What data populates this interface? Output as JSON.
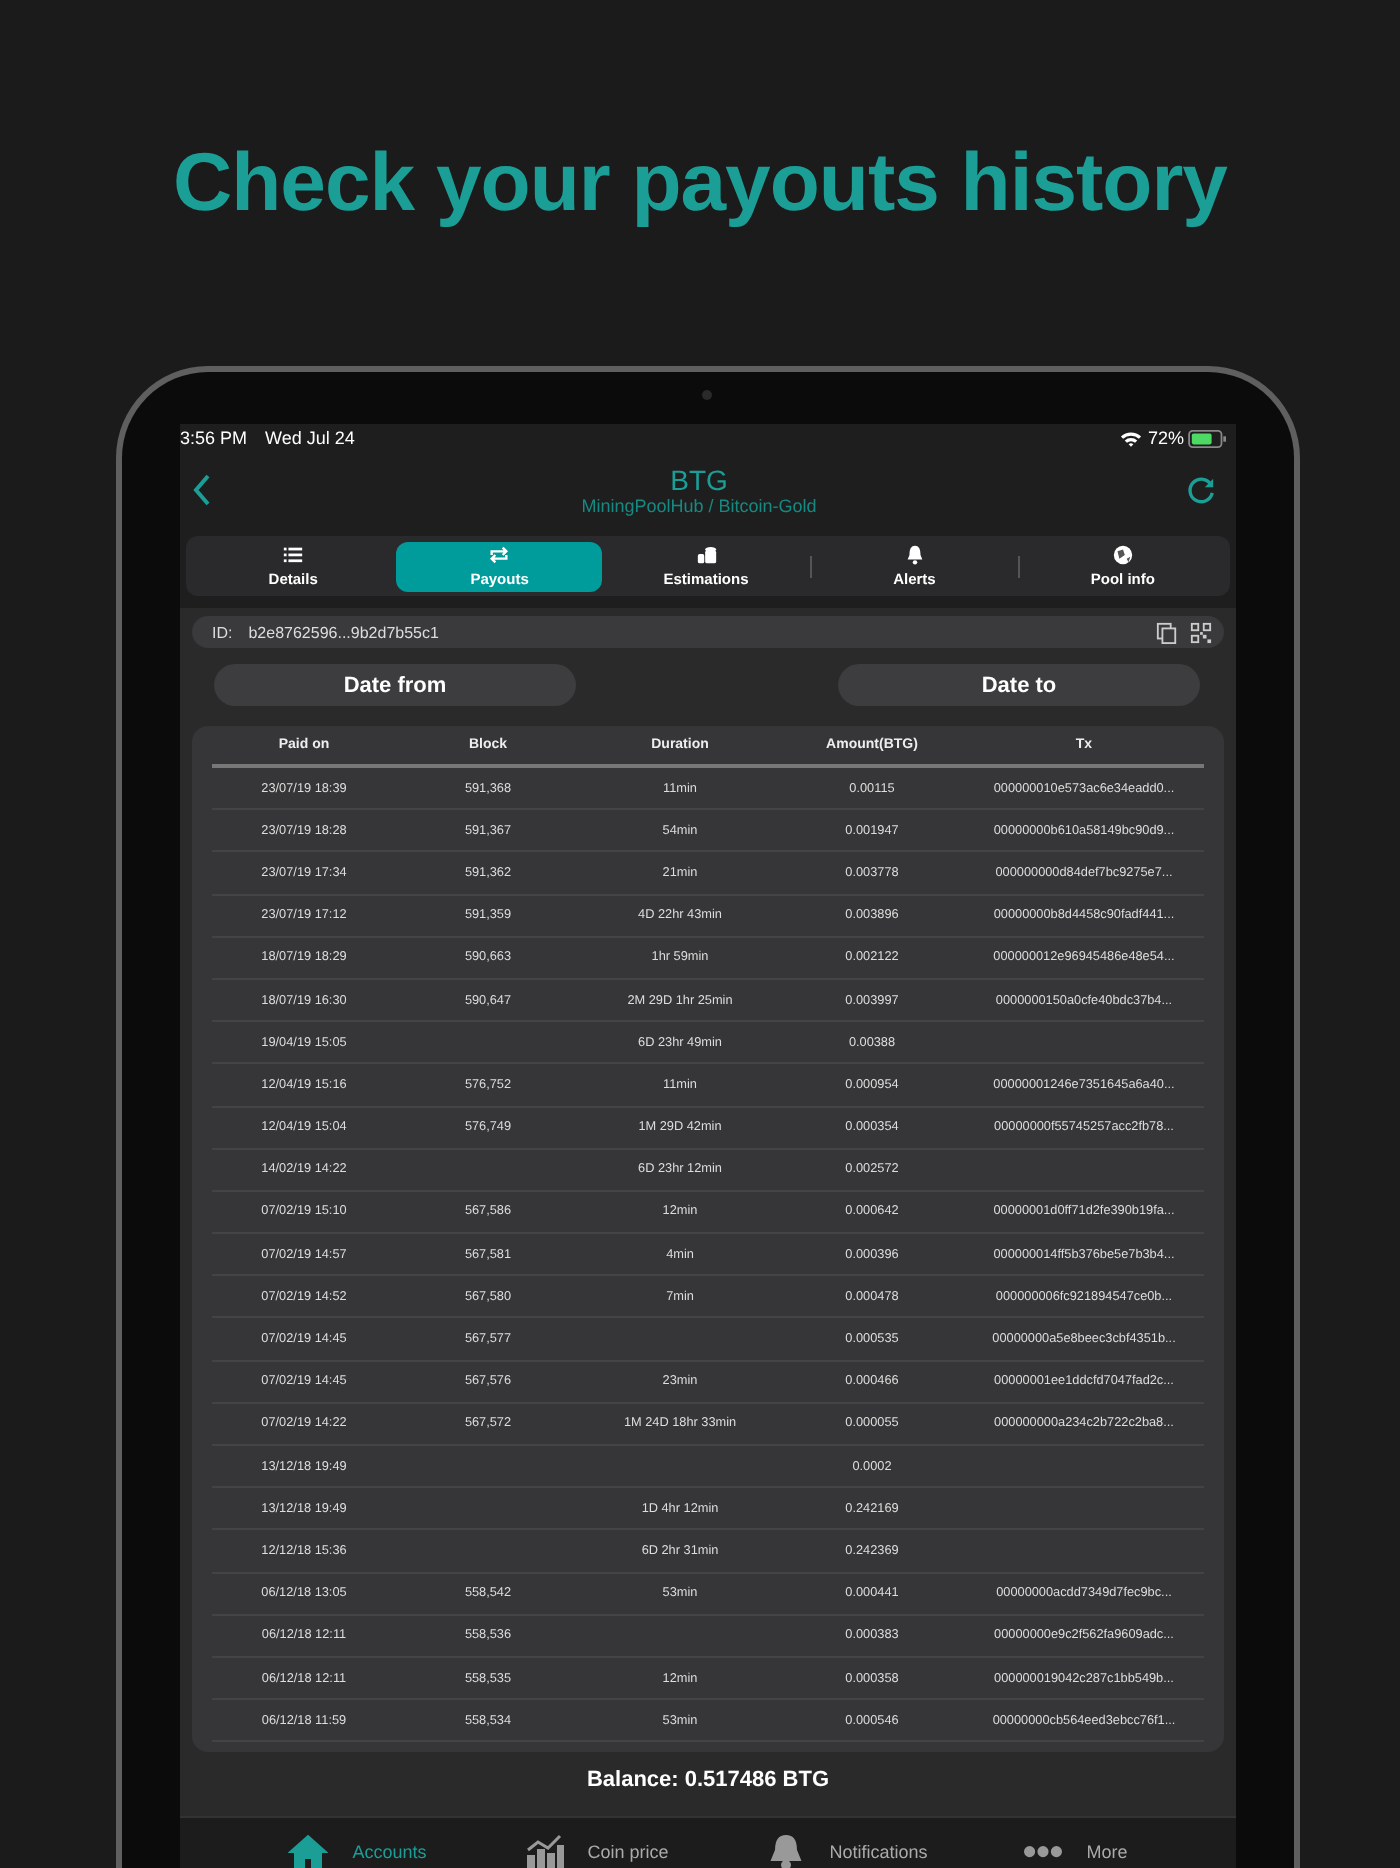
{
  "headline": "Check your payouts history",
  "status_bar": {
    "time": "3:56 PM",
    "date": "Wed Jul 24",
    "battery": "72%"
  },
  "nav": {
    "title": "BTG",
    "subtitle": "MiningPoolHub / Bitcoin-Gold"
  },
  "tabs": [
    {
      "label": "Details",
      "selected": false
    },
    {
      "label": "Payouts",
      "selected": true
    },
    {
      "label": "Estimations",
      "selected": false
    },
    {
      "label": "Alerts",
      "selected": false
    },
    {
      "label": "Pool info",
      "selected": false
    }
  ],
  "id_field": {
    "label": "ID:",
    "value": "b2e8762596...9b2d7b55c1"
  },
  "date_buttons": [
    "Date from",
    "Date to"
  ],
  "table": {
    "columns": [
      "Paid on",
      "Block",
      "Duration",
      "Amount(BTG)",
      "Tx"
    ],
    "rows": [
      [
        "23/07/19 18:39",
        "591,368",
        "11min",
        "0.00115",
        "000000010e573ac6e34eadd0..."
      ],
      [
        "23/07/19 18:28",
        "591,367",
        "54min",
        "0.001947",
        "00000000b610a58149bc90d9..."
      ],
      [
        "23/07/19 17:34",
        "591,362",
        "21min",
        "0.003778",
        "000000000d84def7bc9275e7..."
      ],
      [
        "23/07/19 17:12",
        "591,359",
        "4D 22hr 43min",
        "0.003896",
        "00000000b8d4458c90fadf441..."
      ],
      [
        "18/07/19 18:29",
        "590,663",
        "1hr 59min",
        "0.002122",
        "000000012e96945486e48e54..."
      ],
      [
        "18/07/19 16:30",
        "590,647",
        "2M 29D 1hr 25min",
        "0.003997",
        "0000000150a0cfe40bdc37b4..."
      ],
      [
        "19/04/19 15:05",
        "",
        "6D 23hr 49min",
        "0.00388",
        ""
      ],
      [
        "12/04/19 15:16",
        "576,752",
        "11min",
        "0.000954",
        "00000001246e7351645a6a40..."
      ],
      [
        "12/04/19 15:04",
        "576,749",
        "1M 29D 42min",
        "0.000354",
        "00000000f55745257acc2fb78..."
      ],
      [
        "14/02/19 14:22",
        "",
        "6D 23hr 12min",
        "0.002572",
        ""
      ],
      [
        "07/02/19 15:10",
        "567,586",
        "12min",
        "0.000642",
        "00000001d0ff71d2fe390b19fa..."
      ],
      [
        "07/02/19 14:57",
        "567,581",
        "4min",
        "0.000396",
        "000000014ff5b376be5e7b3b4..."
      ],
      [
        "07/02/19 14:52",
        "567,580",
        "7min",
        "0.000478",
        "000000006fc921894547ce0b..."
      ],
      [
        "07/02/19 14:45",
        "567,577",
        "",
        "0.000535",
        "00000000a5e8beec3cbf4351b..."
      ],
      [
        "07/02/19 14:45",
        "567,576",
        "23min",
        "0.000466",
        "00000001ee1ddcfd7047fad2c..."
      ],
      [
        "07/02/19 14:22",
        "567,572",
        "1M 24D 18hr 33min",
        "0.000055",
        "000000000a234c2b722c2ba8..."
      ],
      [
        "13/12/18 19:49",
        "",
        "",
        "0.0002",
        ""
      ],
      [
        "13/12/18 19:49",
        "",
        "1D 4hr 12min",
        "0.242169",
        ""
      ],
      [
        "12/12/18 15:36",
        "",
        "6D 2hr 31min",
        "0.242369",
        ""
      ],
      [
        "06/12/18 13:05",
        "558,542",
        "53min",
        "0.000441",
        "00000000acdd7349d7fec9bc..."
      ],
      [
        "06/12/18 12:11",
        "558,536",
        "",
        "0.000383",
        "00000000e9c2f562fa9609adc..."
      ],
      [
        "06/12/18 12:11",
        "558,535",
        "12min",
        "0.000358",
        "000000019042c287c1bb549b..."
      ],
      [
        "06/12/18 11:59",
        "558,534",
        "53min",
        "0.000546",
        "00000000cb564eed3ebcc76f1..."
      ]
    ]
  },
  "balance": "Balance: 0.517486 BTG",
  "bottom_tabs": [
    {
      "label": "Accounts",
      "selected": true
    },
    {
      "label": "Coin price",
      "selected": false
    },
    {
      "label": "Notifications",
      "selected": false
    },
    {
      "label": "More",
      "selected": false
    }
  ]
}
